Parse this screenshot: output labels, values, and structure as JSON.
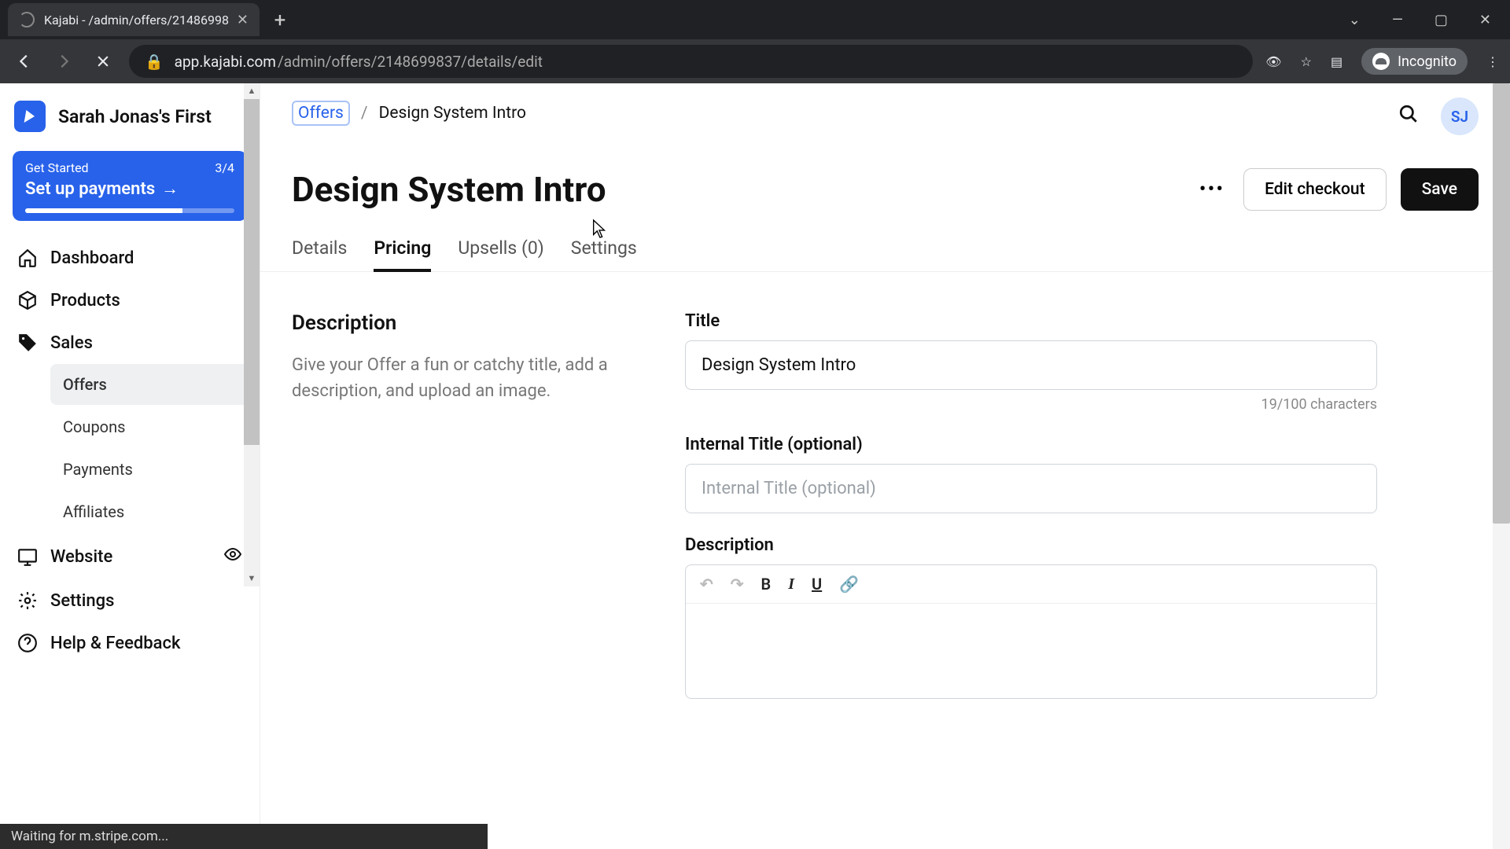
{
  "browser": {
    "tab_title": "Kajabi - /admin/offers/21486998",
    "url_host": "app.kajabi.com",
    "url_path": "/admin/offers/2148699837/details/edit",
    "incognito": "Incognito",
    "status": "Waiting for m.stripe.com...",
    "window_controls": {
      "dropdown": "⌄",
      "min": "—",
      "max": "▢",
      "close": "✕"
    }
  },
  "sidebar": {
    "workspace": "Sarah Jonas's First",
    "get_started": {
      "label": "Get Started",
      "count": "3/4",
      "action": "Set up payments"
    },
    "items": [
      {
        "label": "Dashboard"
      },
      {
        "label": "Products"
      },
      {
        "label": "Sales"
      },
      {
        "label": "Website"
      },
      {
        "label": "Settings"
      },
      {
        "label": "Help & Feedback"
      }
    ],
    "sales_sub": [
      {
        "label": "Offers",
        "active": true
      },
      {
        "label": "Coupons"
      },
      {
        "label": "Payments"
      },
      {
        "label": "Affiliates"
      }
    ]
  },
  "header": {
    "crumb_parent": "Offers",
    "crumb_sep": "/",
    "crumb_current": "Design System Intro",
    "avatar": "SJ"
  },
  "page": {
    "title": "Design System Intro",
    "more": "•••",
    "edit_checkout": "Edit checkout",
    "save": "Save",
    "tabs": [
      {
        "label": "Details"
      },
      {
        "label": "Pricing",
        "active": true
      },
      {
        "label": "Upsells (0)"
      },
      {
        "label": "Settings"
      }
    ]
  },
  "section": {
    "heading": "Description",
    "help": "Give your Offer a fun or catchy title, add a description, and upload an image."
  },
  "form": {
    "title_label": "Title",
    "title_value": "Design System Intro",
    "title_hint": "19/100 characters",
    "internal_label": "Internal Title (optional)",
    "internal_placeholder": "Internal Title (optional)",
    "desc_label": "Description",
    "rte": {
      "undo": "↶",
      "redo": "↷",
      "bold": "B",
      "italic": "I",
      "underline": "U",
      "link": "🔗"
    }
  }
}
